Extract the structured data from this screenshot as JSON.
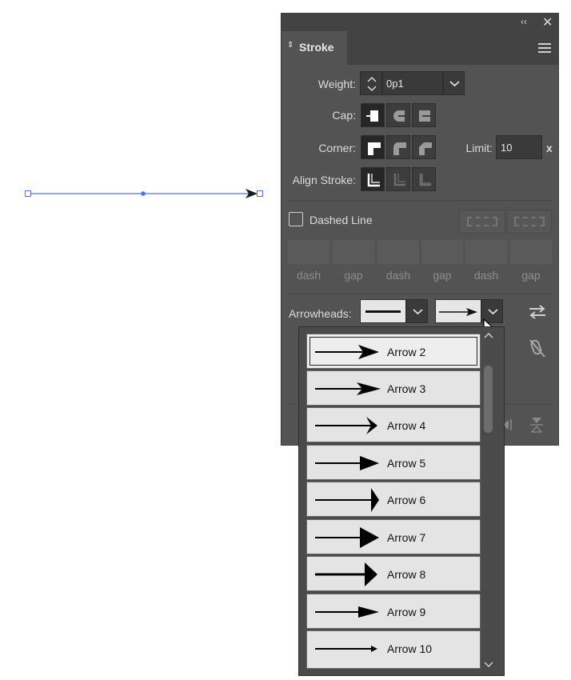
{
  "panel": {
    "title": "Stroke",
    "weight_label": "Weight:",
    "weight_value": "0p1",
    "cap_label": "Cap:",
    "corner_label": "Corner:",
    "limit_label": "Limit:",
    "limit_value": "10",
    "limit_suffix": "x",
    "align_label": "Align Stroke:",
    "dashed_label": "Dashed Line",
    "dash_fields": [
      "dash",
      "gap",
      "dash",
      "gap",
      "dash",
      "gap"
    ],
    "arrowheads_label": "Arrowheads:"
  },
  "dropdown": {
    "items": [
      "Arrow 2",
      "Arrow 3",
      "Arrow 4",
      "Arrow 5",
      "Arrow 6",
      "Arrow 7",
      "Arrow 8",
      "Arrow 9",
      "Arrow 10"
    ],
    "selected": "Arrow 2"
  },
  "colors": {
    "panel_bg": "#535353",
    "selection_blue": "#4a74e8"
  },
  "icons": {
    "collapse": "double-chevron-left-icon",
    "close": "close-icon",
    "menu": "hamburger-menu-icon",
    "swap": "swap-arrows-icon",
    "unlink": "unlink-icon"
  }
}
